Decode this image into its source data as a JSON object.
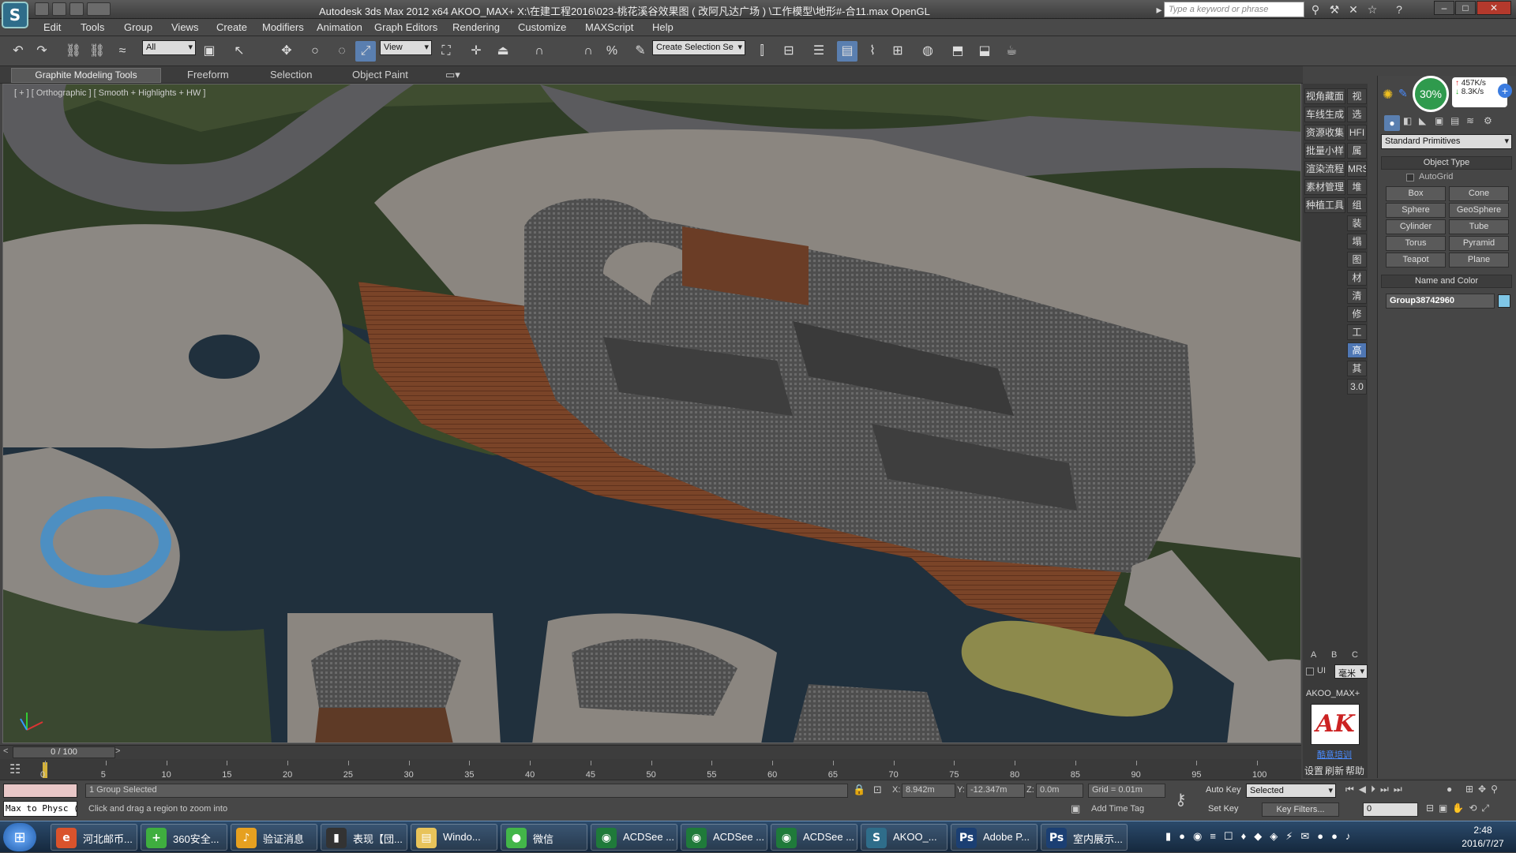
{
  "window": {
    "title": "Autodesk 3ds Max  2012 x64     AKOO_MAX+     X:\\在建工程2016\\023-桃花溪谷效果图 ( 改阿凡达广场 ) \\工作模型\\地形#-合11.max      OpenGL",
    "search_placeholder": "Type a keyword or phrase",
    "logo_glyph": "S"
  },
  "menu": [
    "Edit",
    "Tools",
    "Group",
    "Views",
    "Create",
    "Modifiers",
    "Animation",
    "Graph Editors",
    "Rendering",
    "Customize",
    "MAXScript",
    "Help"
  ],
  "toolbar": {
    "selection_filter": "All",
    "ref_coord": "View",
    "named_selection": "Create Selection Se"
  },
  "ribbon_tabs": [
    "Graphite Modeling Tools",
    "Freeform",
    "Selection",
    "Object Paint"
  ],
  "viewport": {
    "label": "[ + ] [ Orthographic ] [ Smooth + Highlights + HW ]"
  },
  "cn_tools": {
    "col1": [
      "视角藏面",
      "车线生成",
      "资源收集",
      "批量小样",
      "渲染流程",
      "素材管理",
      "种植工具"
    ],
    "col2": [
      "视图",
      "选择",
      "HFI",
      "属性",
      "MRS",
      "堆栈",
      "组",
      "装载",
      "塌陷",
      "图形",
      "材质",
      "清理",
      "修改",
      "工具",
      "高级",
      "其它",
      "3.0"
    ],
    "abc": [
      "A",
      "B",
      "C"
    ],
    "ui_check": "UI",
    "unit": "毫米",
    "plugin_name": "AKOO_MAX+",
    "plugin_logo": "AK",
    "plugin_link": "酷意培训",
    "bottom": [
      "设置",
      "刷新",
      "帮助"
    ]
  },
  "net_meter": {
    "percent": "30%",
    "up": "457K/s",
    "down": "8.3K/s"
  },
  "command_panel": {
    "category": "Standard Primitives",
    "object_type_title": "Object Type",
    "autogrid": "AutoGrid",
    "primitives": [
      "Box",
      "Cone",
      "Sphere",
      "GeoSphere",
      "Cylinder",
      "Tube",
      "Torus",
      "Pyramid",
      "Teapot",
      "Plane"
    ],
    "name_color_title": "Name and Color",
    "object_name": "Group38742960",
    "object_color": "#7fc6e6"
  },
  "timeline": {
    "frame": "0 / 100",
    "ticks": [
      "0",
      "5",
      "10",
      "15",
      "20",
      "25",
      "30",
      "35",
      "40",
      "45",
      "50",
      "55",
      "60",
      "65",
      "70",
      "75",
      "80",
      "85",
      "90",
      "95",
      "100"
    ]
  },
  "status": {
    "maxscript": "Max to Physc (",
    "selection": "1 Group Selected",
    "prompt": "Click and drag a region to zoom into",
    "x_label": "X:",
    "x": "8.942m",
    "y_label": "Y:",
    "y": "-12.347m",
    "z_label": "Z:",
    "z": "0.0m",
    "grid": "Grid = 0.01m",
    "add_time_tag": "Add Time Tag",
    "auto_key": "Auto Key",
    "set_key": "Set Key",
    "key_mode": "Selected",
    "key_filters": "Key Filters...",
    "frame_field": "0"
  },
  "taskbar": {
    "items": [
      {
        "label": "河北邮币...",
        "color": "#d9532c",
        "glyph": "e"
      },
      {
        "label": "360安全...",
        "color": "#3fae3f",
        "glyph": "+"
      },
      {
        "label": "验证消息",
        "color": "#e6a020",
        "glyph": "♪"
      },
      {
        "label": "表现【団...",
        "color": "#333333",
        "glyph": "▮"
      },
      {
        "label": "Windo...",
        "color": "#e8c35a",
        "glyph": "▤"
      },
      {
        "label": "微信",
        "color": "#43b649",
        "glyph": "●"
      },
      {
        "label": "ACDSee ...",
        "color": "#1f7a3a",
        "glyph": "◉"
      },
      {
        "label": "ACDSee ...",
        "color": "#1f7a3a",
        "glyph": "◉"
      },
      {
        "label": "ACDSee ...",
        "color": "#1f7a3a",
        "glyph": "◉"
      },
      {
        "label": "AKOO_...",
        "color": "#2f6d8a",
        "glyph": "S"
      },
      {
        "label": "Adobe P...",
        "color": "#1b3f73",
        "glyph": "Ps"
      },
      {
        "label": "室内展示...",
        "color": "#1b3f73",
        "glyph": "Ps"
      }
    ],
    "time": "2:48",
    "date": "2016/7/27"
  }
}
